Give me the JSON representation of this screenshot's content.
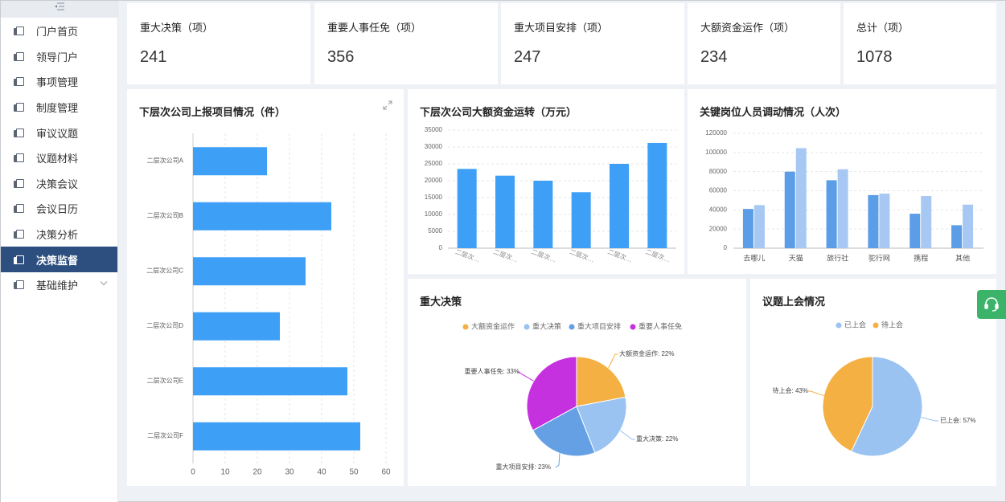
{
  "sidebar": {
    "collapse_icon": "menu-fold-icon",
    "items": [
      {
        "label": "门户首页",
        "icon": "doc-icon"
      },
      {
        "label": "领导门户",
        "icon": "doc-icon"
      },
      {
        "label": "事项管理",
        "icon": "doc-icon"
      },
      {
        "label": "制度管理",
        "icon": "doc-icon"
      },
      {
        "label": "审议议题",
        "icon": "doc-icon"
      },
      {
        "label": "议题材料",
        "icon": "doc-icon"
      },
      {
        "label": "决策会议",
        "icon": "doc-icon"
      },
      {
        "label": "会议日历",
        "icon": "doc-icon"
      },
      {
        "label": "决策分析",
        "icon": "doc-icon"
      },
      {
        "label": "决策监督",
        "icon": "doc-icon",
        "active": true
      },
      {
        "label": "基础维护",
        "icon": "doc-icon",
        "has_children": true
      }
    ]
  },
  "stats": [
    {
      "title": "重大决策（项）",
      "value": "241"
    },
    {
      "title": "重要人事任免（项）",
      "value": "356"
    },
    {
      "title": "重大项目安排（项）",
      "value": "247"
    },
    {
      "title": "大额资金运作（项）",
      "value": "234"
    },
    {
      "title": "总计（项）",
      "value": "1078"
    }
  ],
  "panels": {
    "projects": {
      "title": "下层次公司上报项目情况（件）",
      "expand_icon": "expand-icon"
    },
    "funds": {
      "title": "下层次公司大额资金运转（万元）"
    },
    "staff": {
      "title": "关键岗位人员调动情况（人次）"
    },
    "decisions": {
      "title": "重大决策"
    },
    "topics": {
      "title": "议题上会情况"
    }
  },
  "help_button": {
    "icon": "headset-icon"
  },
  "colors": {
    "bar": "#3d9ff5",
    "bar_light": "#a7c8f2",
    "bar_dark": "#5b9de6",
    "active_nav": "#2c4f7f",
    "help": "#3bb46a"
  },
  "chart_data": [
    {
      "type": "bar",
      "orientation": "horizontal",
      "categories": [
        "二层次公司A",
        "二层次公司B",
        "二层次公司C",
        "二层次公司D",
        "二层次公司E",
        "二层次公司F"
      ],
      "values": [
        23,
        43,
        35,
        27,
        48,
        52
      ],
      "xlim": [
        0,
        60
      ],
      "xticks": [
        "0",
        "10",
        "20",
        "30",
        "40",
        "50",
        "60"
      ],
      "grid": true
    },
    {
      "type": "bar",
      "categories": [
        "二层次…",
        "二层次…",
        "二层次…",
        "二层次…",
        "二层次…",
        "二层次…"
      ],
      "values": [
        23500,
        21500,
        20000,
        16600,
        25000,
        31200
      ],
      "ylim": [
        0,
        35000
      ],
      "yticks": [
        "0",
        "5000",
        "10000",
        "15000",
        "20000",
        "25000",
        "30000",
        "35000"
      ],
      "grid": true
    },
    {
      "type": "bar",
      "categories": [
        "去哪儿",
        "天猫",
        "旅行社",
        "驼行网",
        "携程",
        "其他"
      ],
      "series": [
        {
          "values": [
            41000,
            80000,
            71000,
            55500,
            36000,
            24000
          ]
        },
        {
          "values": [
            45000,
            104500,
            82500,
            57000,
            54500,
            45500
          ]
        }
      ],
      "ylim": [
        0,
        120000
      ],
      "yticks": [
        "0",
        "20000",
        "40000",
        "60000",
        "80000",
        "100000",
        "120000"
      ],
      "grid": true
    },
    {
      "type": "pie",
      "legend": [
        "大额资金运作",
        "重大决策",
        "重大项目安排",
        "重要人事任免"
      ],
      "legend_position": "top",
      "slices": [
        {
          "name": "大额资金运作",
          "value": 22,
          "label": "大额资金运作: 22%",
          "color": "#f4b043"
        },
        {
          "name": "重大决策",
          "value": 22,
          "label": "重大决策: 22%",
          "color": "#9ac3f2"
        },
        {
          "name": "重大项目安排",
          "value": 23,
          "label": "重大项目安排: 23%",
          "color": "#64a0e3"
        },
        {
          "name": "重要人事任免",
          "value": 33,
          "label": "重要人事任免: 33%",
          "color": "#c531de"
        }
      ]
    },
    {
      "type": "pie",
      "legend": [
        "已上会",
        "待上会"
      ],
      "legend_position": "top",
      "slices": [
        {
          "name": "已上会",
          "value": 57,
          "label": "已上会: 57%",
          "color": "#9ac3f2"
        },
        {
          "name": "待上会",
          "value": 43,
          "label": "待上会: 43%",
          "color": "#f4b043"
        }
      ]
    }
  ]
}
